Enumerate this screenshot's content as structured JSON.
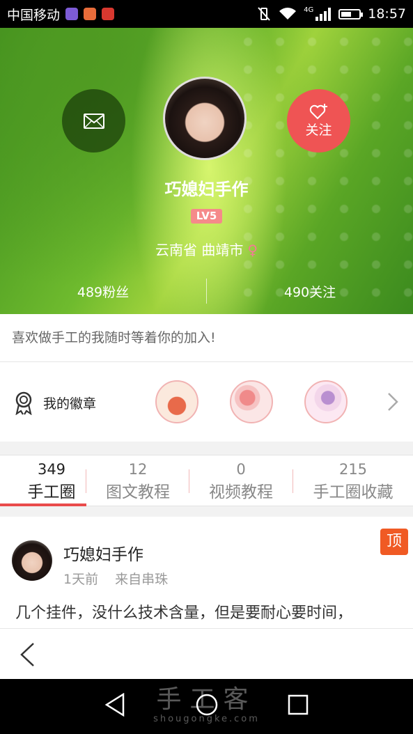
{
  "status_bar": {
    "carrier": "中国移动",
    "network": "4G",
    "time": "18:57",
    "battery_level": 0.6
  },
  "profile": {
    "username": "巧媳妇手作",
    "level": "LV5",
    "location": "云南省 曲靖市",
    "gender_icon": "female-icon",
    "follow_label": "关注",
    "fans": "489粉丝",
    "following": "490关注",
    "bio": "喜欢做手工的我随时等着你的加入!"
  },
  "badges": {
    "title": "我的徽章",
    "items": [
      "bowl-badge",
      "balloons-badge",
      "girl-badge"
    ]
  },
  "tabs": [
    {
      "count": "349",
      "label": "手工圈",
      "active": true
    },
    {
      "count": "12",
      "label": "图文教程"
    },
    {
      "count": "0",
      "label": "视频教程"
    },
    {
      "count": "215",
      "label": "手工圈收藏"
    }
  ],
  "post": {
    "author": "巧媳妇手作",
    "time": "1天前",
    "source": "来自串珠",
    "pin_label": "顶",
    "text": "几个挂件，没什么技术含量，但是要耐心要时间，"
  },
  "watermark": {
    "text": "手工客",
    "url": "shougongke.com"
  },
  "colors": {
    "accent_red": "#e94b4b",
    "follow_button": "#ef5454",
    "pin_orange": "#f05a24",
    "level_badge": "#f58a8a"
  }
}
